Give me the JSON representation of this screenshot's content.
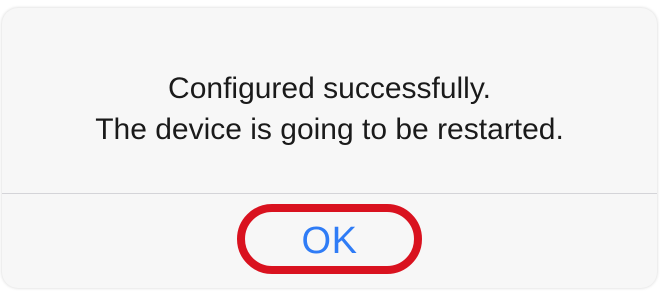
{
  "alert": {
    "message_line_1": "Configured successfully.",
    "message_line_2": "The device is going to be restarted.",
    "ok_label": "OK"
  },
  "colors": {
    "alert_background": "#f7f7f7",
    "message_text": "#1a1a1a",
    "action_text": "#2f7cf6",
    "highlight_ring": "#d9121f",
    "divider": "#d4d4d8"
  }
}
